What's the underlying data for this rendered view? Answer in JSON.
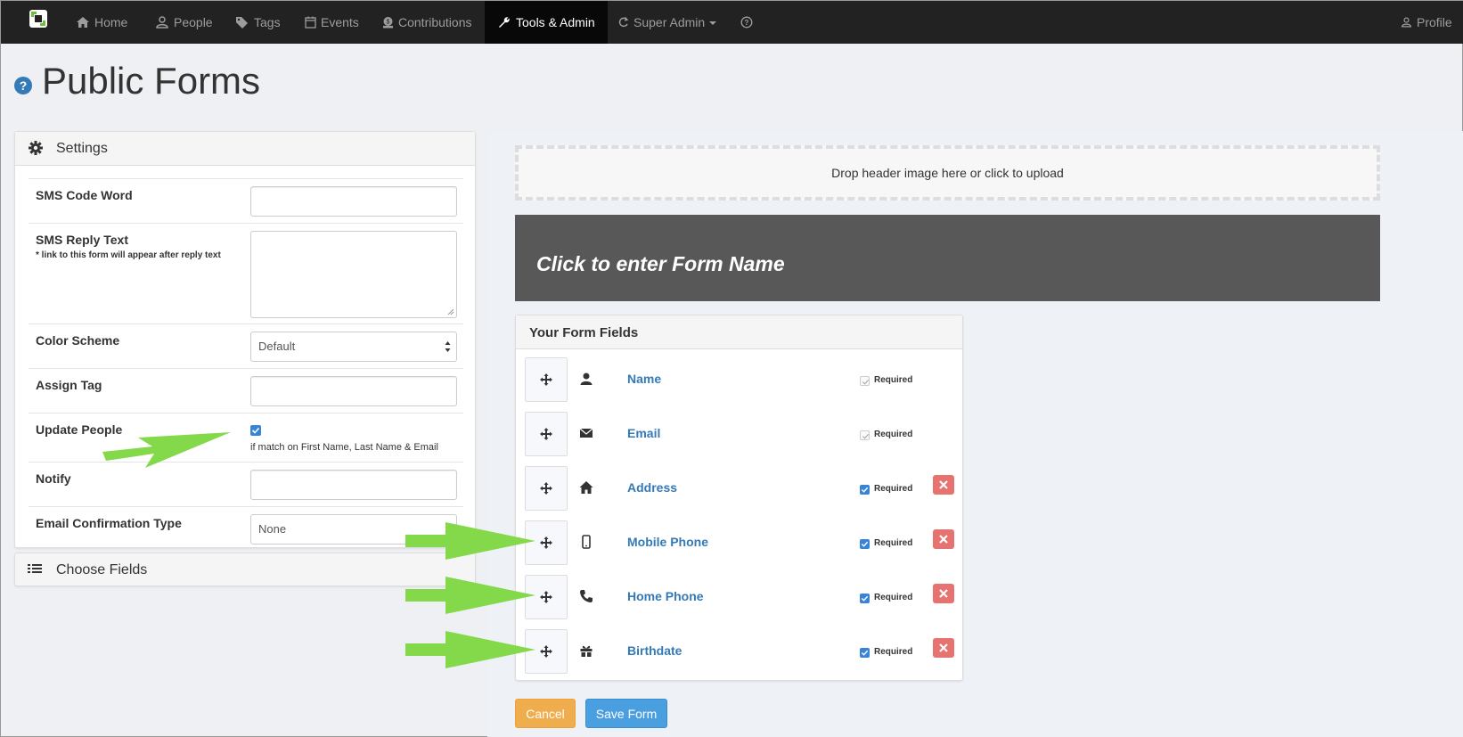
{
  "nav": {
    "items": [
      {
        "label": "Home",
        "icon": "home-icon"
      },
      {
        "label": "People",
        "icon": "user-icon"
      },
      {
        "label": "Tags",
        "icon": "tags-icon"
      },
      {
        "label": "Events",
        "icon": "calendar-icon"
      },
      {
        "label": "Contributions",
        "icon": "money-icon"
      },
      {
        "label": "Tools & Admin",
        "icon": "wrench-icon"
      },
      {
        "label": "Super Admin",
        "icon": "refresh-icon"
      }
    ],
    "profile": "Profile",
    "active": "Tools & Admin"
  },
  "page": {
    "title": "Public Forms"
  },
  "settings": {
    "heading": "Settings",
    "sms_code_word": {
      "label": "SMS Code Word",
      "value": ""
    },
    "sms_reply_text": {
      "label": "SMS Reply Text",
      "note": "* link to this form will appear after reply text",
      "value": ""
    },
    "color_scheme": {
      "label": "Color Scheme",
      "value": "Default"
    },
    "assign_tag": {
      "label": "Assign Tag",
      "value": ""
    },
    "update_people": {
      "label": "Update People",
      "checked": true,
      "note": "if match on First Name, Last Name & Email"
    },
    "notify": {
      "label": "Notify",
      "value": ""
    },
    "email_confirmation_type": {
      "label": "Email Confirmation Type",
      "value": "None"
    }
  },
  "choose_fields": {
    "heading": "Choose Fields"
  },
  "dropzone": {
    "text": "Drop header image here or click to upload"
  },
  "form_name": {
    "placeholder": "Click to enter Form Name"
  },
  "form_fields": {
    "heading": "Your Form Fields",
    "required_label": "Required",
    "items": [
      {
        "label": "Name",
        "icon": "user-icon",
        "required": true,
        "locked": true
      },
      {
        "label": "Email",
        "icon": "envelope-icon",
        "required": true,
        "locked": true
      },
      {
        "label": "Address",
        "icon": "home-icon",
        "required": true,
        "locked": false
      },
      {
        "label": "Mobile Phone",
        "icon": "mobile-phone-icon",
        "required": true,
        "locked": false
      },
      {
        "label": "Home Phone",
        "icon": "phone-icon",
        "required": true,
        "locked": false
      },
      {
        "label": "Birthdate",
        "icon": "gift-icon",
        "required": true,
        "locked": false
      }
    ]
  },
  "actions": {
    "cancel": "Cancel",
    "save": "Save Form"
  },
  "colors": {
    "navbar": "#222222",
    "link": "#337ab7",
    "cancel": "#f0ad4e",
    "save": "#4a9fe0",
    "remove": "#e6736f",
    "annotation_arrow": "#84d94b"
  }
}
